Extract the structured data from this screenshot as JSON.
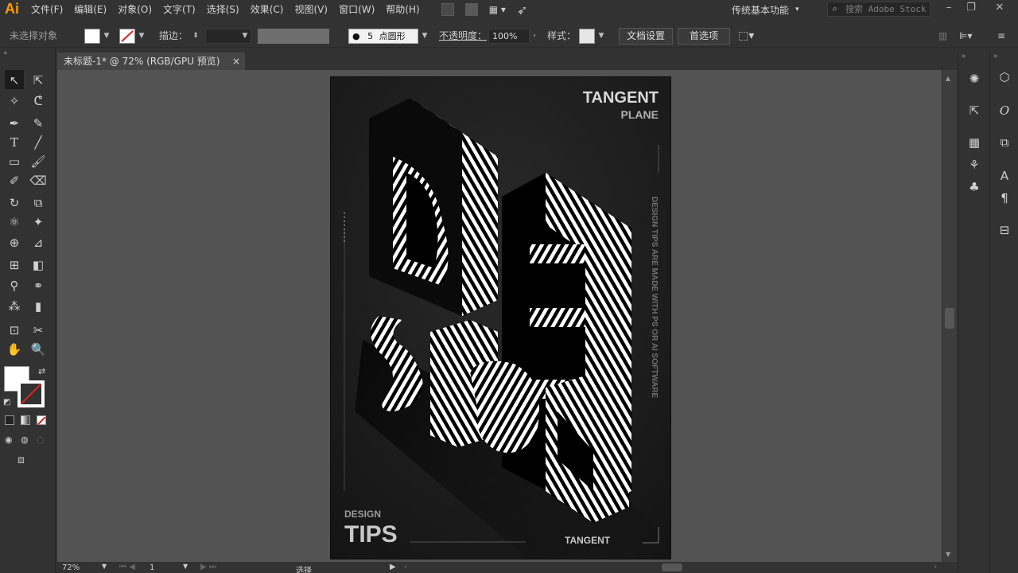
{
  "app": {
    "logo": "Ai"
  },
  "menus": [
    "文件(F)",
    "编辑(E)",
    "对象(O)",
    "文字(T)",
    "选择(S)",
    "效果(C)",
    "视图(V)",
    "窗口(W)",
    "帮助(H)"
  ],
  "workspace": {
    "label": "传统基本功能"
  },
  "search": {
    "placeholder": "搜索 Adobe Stock"
  },
  "control": {
    "selection_status": "未选择对象",
    "stroke_label": "描边：",
    "brush_size": "5",
    "brush_name": "点圆形",
    "opacity_label": "不透明度：",
    "opacity_value": "100%",
    "style_label": "样式：",
    "doc_setup": "文档设置",
    "preferences": "首选项"
  },
  "document": {
    "tab_title": "未标题-1* @ 72% (RGB/GPU 预览)",
    "close": "×"
  },
  "artwork": {
    "brand1": "TANGENT",
    "brand2": "PLANE",
    "side_text": "DESIGN TIPS ARE MADE WITH PS OR AI SOFTWARE",
    "small_title": "DESIGN",
    "big_title": "TIPS",
    "bottom_brand": "TANGENT",
    "letters": [
      "D",
      "E",
      "S",
      "I",
      "G",
      "N"
    ]
  },
  "status": {
    "zoom": "72%",
    "page": "1",
    "tool": "选择"
  },
  "colors": {
    "accent": "#ff9a00",
    "canvas": "#535353",
    "ui_bg": "#323232",
    "artboard": "#1e1e1e"
  }
}
